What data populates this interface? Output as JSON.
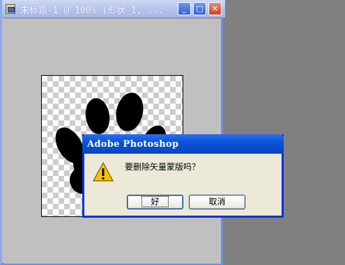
{
  "document_window": {
    "title": "未标题-1 @ 100% (形状 1, ...",
    "minimize_label": "_",
    "maximize_label": "□",
    "close_label": "✕"
  },
  "dialog": {
    "title": "Adobe Photoshop",
    "message": "要删除矢量蒙版吗？",
    "ok_label": "好",
    "cancel_label": "取消",
    "icon": "warning-icon"
  },
  "colors": {
    "dialog_title_bar": "#0a53d6",
    "dialog_body": "#ece9d8",
    "workspace": "#808080",
    "warning": "#f5c400"
  }
}
